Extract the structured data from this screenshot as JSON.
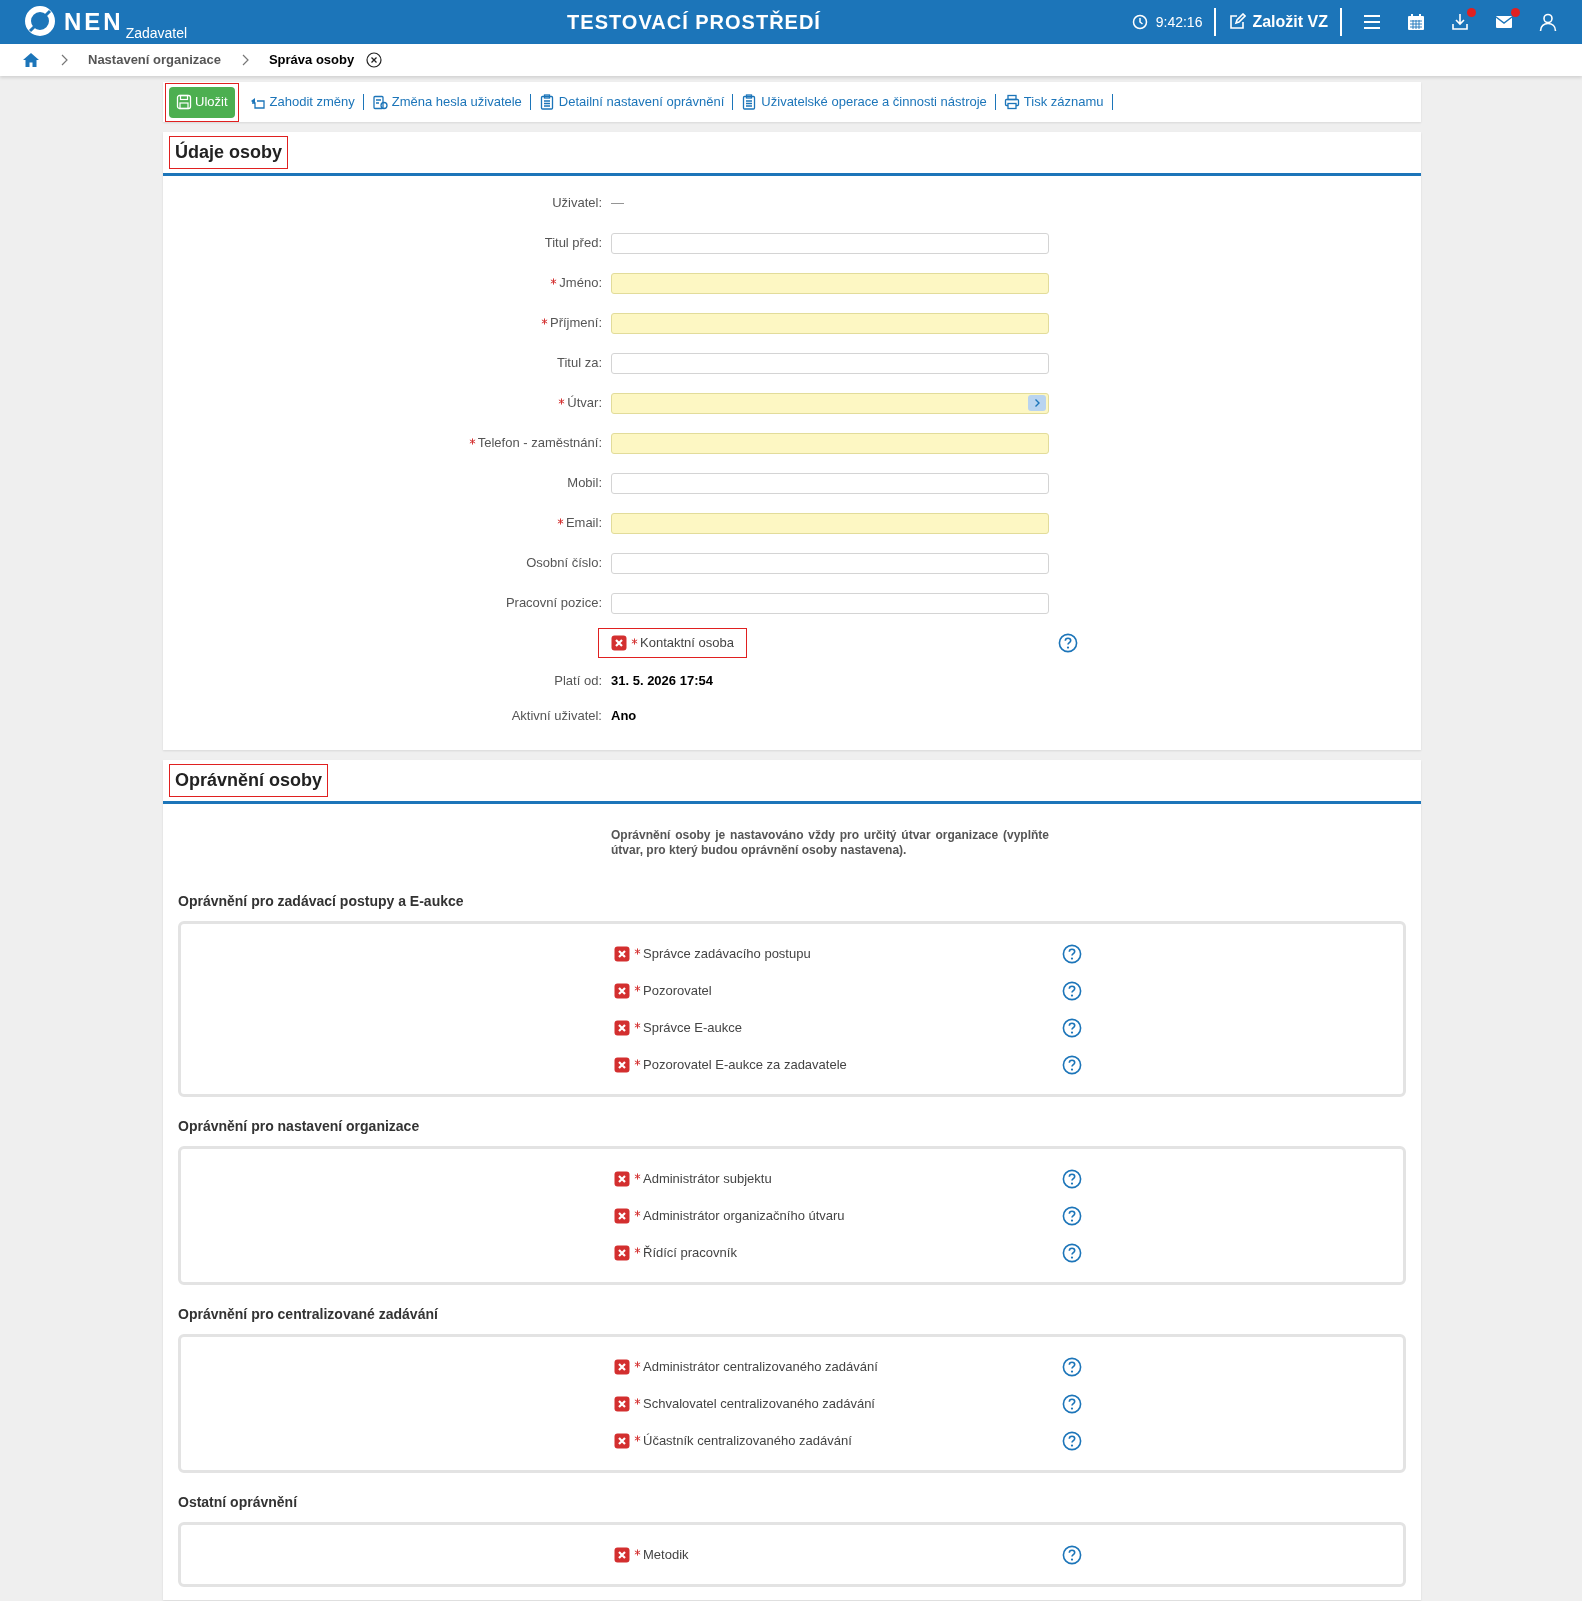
{
  "header": {
    "logo": "NEN",
    "subtitle": "Zadavatel",
    "title": "TESTOVACÍ PROSTŘEDÍ",
    "time": "9:42:16",
    "create_button": "Založit VZ",
    "icons": [
      {
        "notification": false
      },
      {
        "notification": false
      },
      {
        "notification": true
      },
      {
        "notification": true
      },
      {
        "notification": false
      }
    ]
  },
  "breadcrumb": [
    {
      "label": "Nastavení organizace",
      "current": false
    },
    {
      "label": "Správa osoby",
      "current": true
    }
  ],
  "toolbar": [
    {
      "kind": "primary",
      "label": "Uložit",
      "highlighted": true
    },
    {
      "kind": "link",
      "label": "Zahodit změny",
      "highlighted": false
    },
    {
      "kind": "link",
      "label": "Změna hesla uživatele",
      "highlighted": false
    },
    {
      "kind": "link",
      "label": "Detailní nastavení oprávnění",
      "highlighted": false
    },
    {
      "kind": "link",
      "label": "Uživatelské operace a činnosti nástroje",
      "highlighted": false
    },
    {
      "kind": "link",
      "label": "Tisk záznamu",
      "highlighted": false
    }
  ],
  "person": {
    "title": "Údaje osoby",
    "highlighted": true,
    "fields": [
      {
        "kind": "text",
        "label": "Uživatel:",
        "value": "—"
      },
      {
        "kind": "input",
        "label": "Titul před:",
        "required": false
      },
      {
        "kind": "input",
        "label": "Jméno:",
        "required": true
      },
      {
        "kind": "input",
        "label": "Příjmení:",
        "required": true
      },
      {
        "kind": "input",
        "label": "Titul za:",
        "required": false
      },
      {
        "kind": "lookup",
        "label": "Útvar:",
        "required": true
      },
      {
        "kind": "input",
        "label": "Telefon - zaměstnání:",
        "required": true
      },
      {
        "kind": "input",
        "label": "Mobil:",
        "required": false
      },
      {
        "kind": "input",
        "label": "Email:",
        "required": true
      },
      {
        "kind": "input",
        "label": "Osobní číslo:",
        "required": false
      },
      {
        "kind": "input",
        "label": "Pracovní pozice:",
        "required": false
      },
      {
        "kind": "checkbox",
        "label": "Kontaktní osoba",
        "required": true,
        "checked": false,
        "highlighted": true
      },
      {
        "kind": "value",
        "label": "Platí od:",
        "value": "31. 5. 2026 17:54"
      },
      {
        "kind": "value",
        "label": "Aktivní uživatel:",
        "value": "Ano"
      }
    ]
  },
  "permissions": {
    "title": "Oprávnění osoby",
    "highlighted": true,
    "note": "Oprávnění osoby je nastavováno vždy pro určitý útvar organizace (vyplňte útvar, pro který budou oprávnění osoby nastavena).",
    "groups": [
      {
        "title": "Oprávnění pro zadávací postupy a E-aukce",
        "items": [
          {
            "label": "Správce zadávacího postupu",
            "required": true,
            "checked": false
          },
          {
            "label": "Pozorovatel",
            "required": true,
            "checked": false
          },
          {
            "label": "Správce E-aukce",
            "required": true,
            "checked": false
          },
          {
            "label": "Pozorovatel E-aukce za zadavatele",
            "required": true,
            "checked": false
          }
        ]
      },
      {
        "title": "Oprávnění pro nastavení organizace",
        "items": [
          {
            "label": "Administrátor subjektu",
            "required": true,
            "checked": false
          },
          {
            "label": "Administrátor organizačního útvaru",
            "required": true,
            "checked": false
          },
          {
            "label": "Řídící pracovník",
            "required": true,
            "checked": false
          }
        ]
      },
      {
        "title": "Oprávnění pro centralizované zadávání",
        "items": [
          {
            "label": "Administrátor centralizovaného zadávání",
            "required": true,
            "checked": false
          },
          {
            "label": "Schvalovatel centralizovaného zadávání",
            "required": true,
            "checked": false
          },
          {
            "label": "Účastník centralizovaného zadávání",
            "required": true,
            "checked": false
          }
        ]
      },
      {
        "title": "Ostatní oprávnění",
        "items": [
          {
            "label": "Metodik",
            "required": true,
            "checked": false
          }
        ]
      }
    ]
  }
}
